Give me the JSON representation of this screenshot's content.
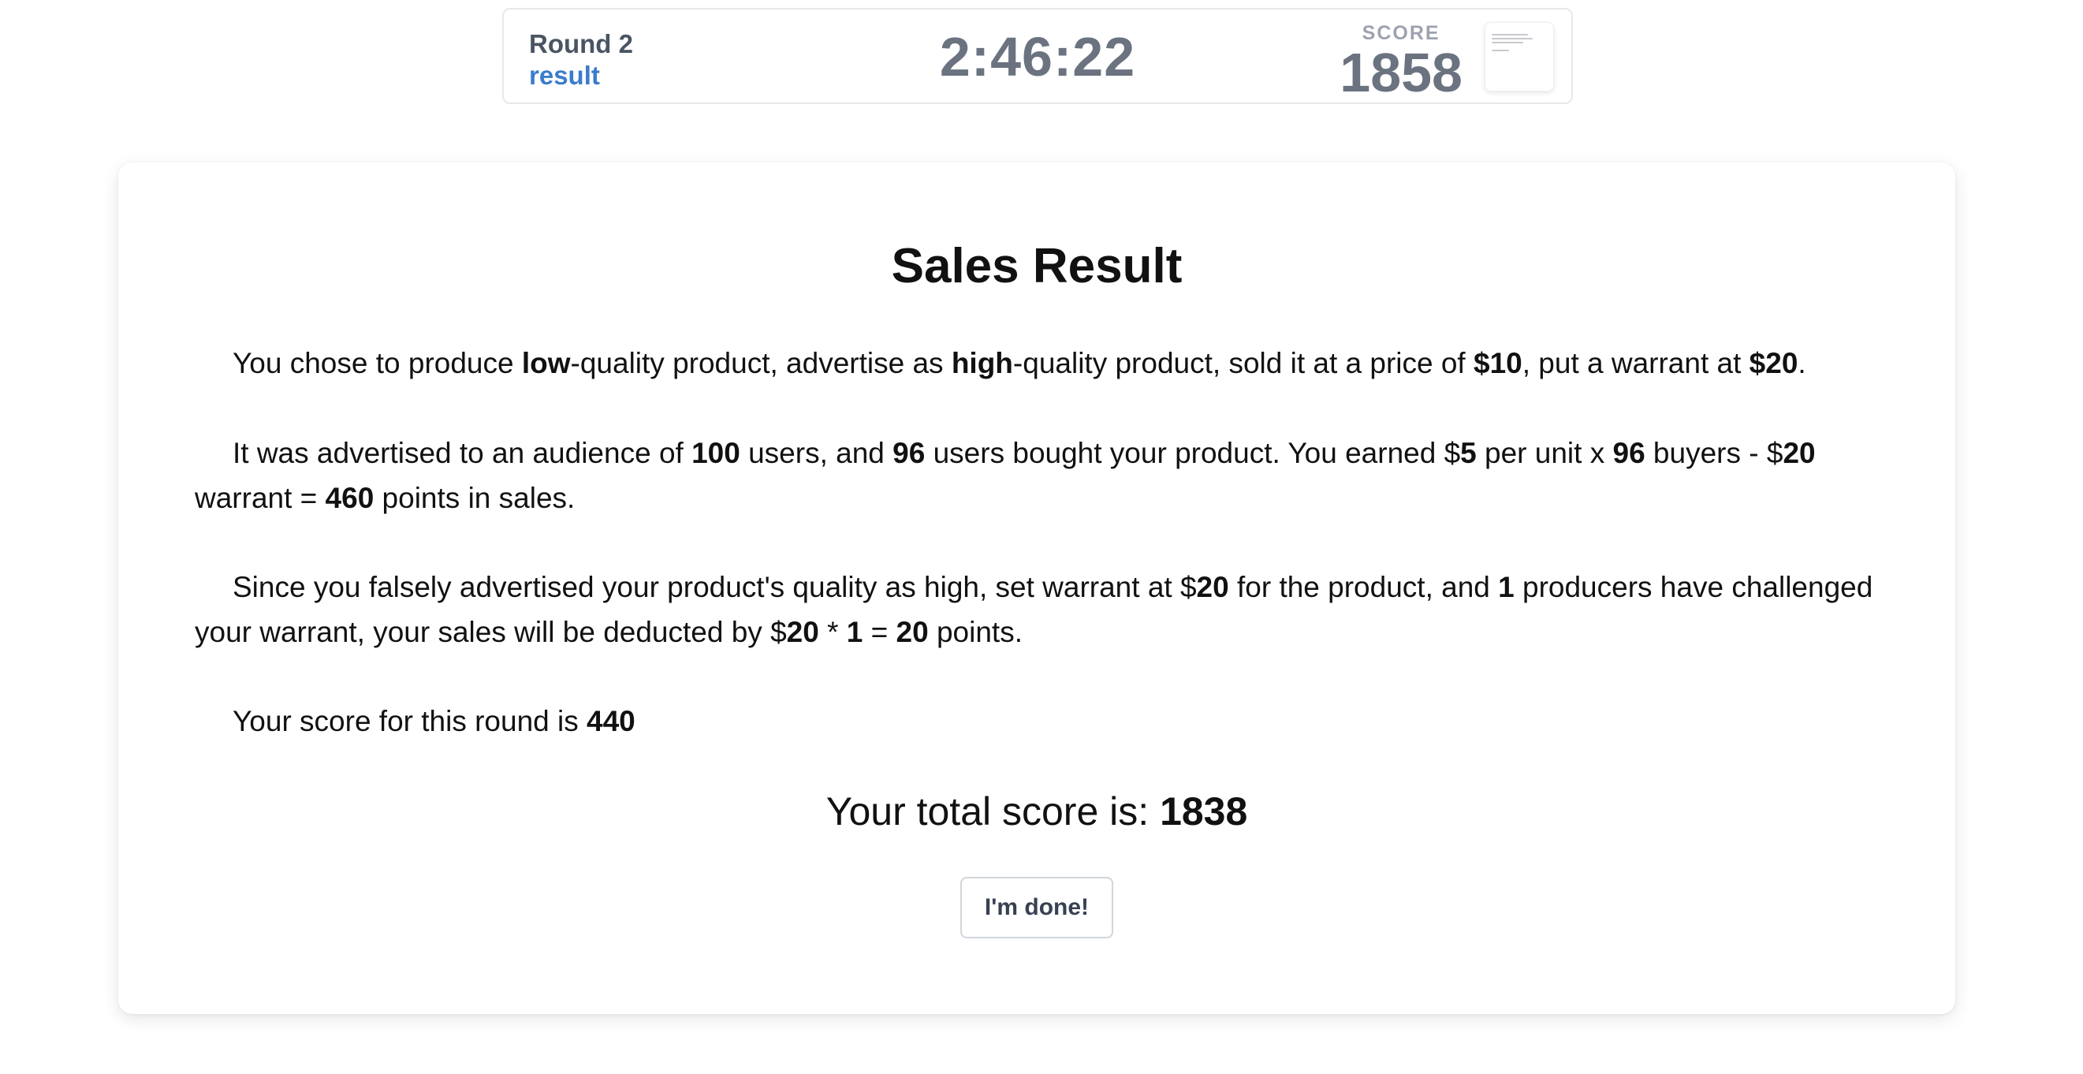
{
  "header": {
    "round_label": "Round 2",
    "stage": "result",
    "timer": "2:46:22",
    "score_label": "SCORE",
    "score_value": "1858"
  },
  "card": {
    "title": "Sales Result",
    "p1": {
      "t1": "You chose to produce ",
      "quality": "low",
      "t2": "-quality product, advertise as ",
      "advertised": "high",
      "t3": "-quality product, sold it at a price of ",
      "price": "$10",
      "t4": ", put a warrant at ",
      "warrant": "$20",
      "t5": "."
    },
    "p2": {
      "t1": "It was advertised to an audience of ",
      "audience": "100",
      "t2": " users, and ",
      "buyers": "96",
      "t3": " users bought your product. You earned $",
      "per_unit": "5",
      "t4": " per unit x ",
      "buyers2": "96",
      "t5": " buyers - $",
      "warrant": "20",
      "t6": " warrant = ",
      "sales_points": "460",
      "t7": " points in sales."
    },
    "p3": {
      "t1": "Since you falsely advertised your product's quality as high, set warrant at $",
      "warrant": "20",
      "t2": " for the product, and ",
      "challengers": "1",
      "t3": " producers have challenged your warrant, your sales will be deducted by $",
      "deduct_amount": "20",
      "t4": " * ",
      "deduct_count": "1",
      "t5": " = ",
      "deduct_total": "20",
      "t6": " points."
    },
    "p4": {
      "t1": "Your score for this round is ",
      "round_score": "440"
    },
    "total": {
      "label": "Your total score is: ",
      "value": "1838"
    },
    "done_button": "I'm done!"
  },
  "colors": {
    "accent": "#3b7ccc",
    "muted_text": "#6b7280",
    "label_text": "#9ca3af"
  }
}
